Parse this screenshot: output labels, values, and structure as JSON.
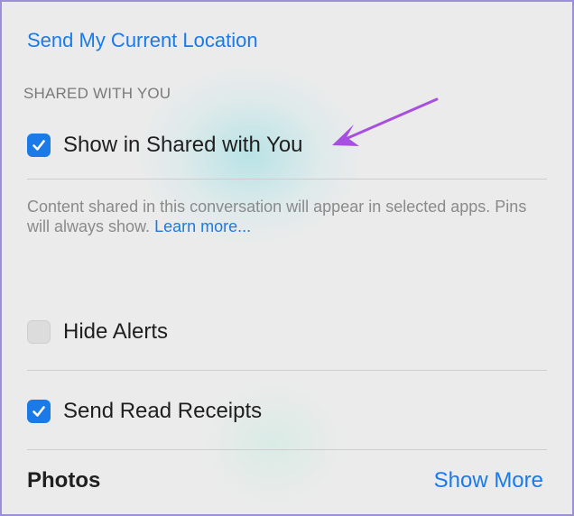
{
  "location": {
    "send_current_location_label": "Send My Current Location"
  },
  "shared_with_you": {
    "header": "SHARED WITH YOU",
    "show_in_shared_label": "Show in Shared with You",
    "show_in_shared_checked": true,
    "description": "Content shared in this conversation will appear in selected apps. Pins will always show.",
    "learn_more_label": "Learn more..."
  },
  "options": {
    "hide_alerts_label": "Hide Alerts",
    "hide_alerts_checked": false,
    "send_read_receipts_label": "Send Read Receipts",
    "send_read_receipts_checked": true
  },
  "photos": {
    "title": "Photos",
    "show_more_label": "Show More"
  },
  "colors": {
    "accent": "#1a7ae8",
    "annotation_arrow": "#a64fe0",
    "frame_border": "#9b8fd6"
  }
}
